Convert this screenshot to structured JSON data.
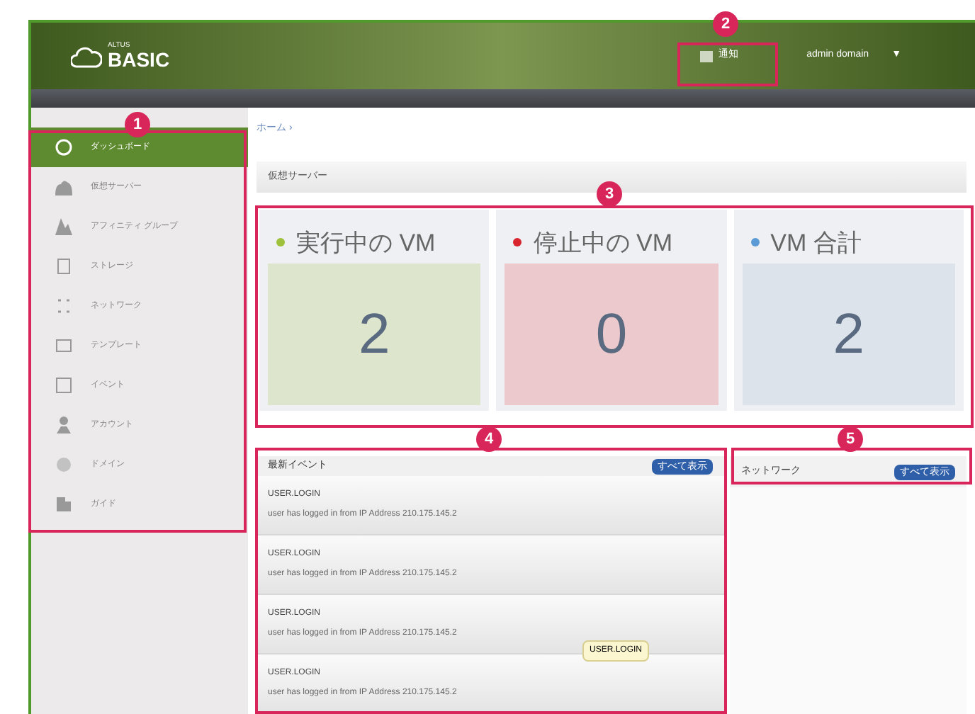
{
  "header": {
    "logo_small": "ALTUS",
    "logo": "BASIC",
    "notification": "通知",
    "account": "admin domain",
    "caret": "▼"
  },
  "sidebar": {
    "items": [
      {
        "label": "ダッシュボード",
        "selected": true
      },
      {
        "label": "仮想サーバー",
        "selected": false
      },
      {
        "label": "アフィニティ グループ",
        "selected": false
      },
      {
        "label": "ストレージ",
        "selected": false
      },
      {
        "label": "ネットワーク",
        "selected": false
      },
      {
        "label": "テンプレート",
        "selected": false
      },
      {
        "label": "イベント",
        "selected": false
      },
      {
        "label": "アカウント",
        "selected": false
      },
      {
        "label": "ドメイン",
        "selected": false
      },
      {
        "label": "ガイド",
        "selected": false
      }
    ]
  },
  "breadcrumb": "ホーム ›",
  "section_title": "仮想サーバー",
  "stats": [
    {
      "label": "実行中の VM",
      "value": "2",
      "color": "#9dc13a"
    },
    {
      "label": "停止中の VM",
      "value": "0",
      "color": "#d9262e"
    },
    {
      "label": "VM 合計",
      "value": "2",
      "color": "#5b9bd5"
    }
  ],
  "events": {
    "title": "最新イベント",
    "button": "すべて表示",
    "items": [
      {
        "type": "USER.LOGIN",
        "text": "user has logged in from IP Address 210.175.145.2"
      },
      {
        "type": "USER.LOGIN",
        "text": "user has logged in from IP Address 210.175.145.2"
      },
      {
        "type": "USER.LOGIN",
        "text": "user has logged in from IP Address 210.175.145.2"
      },
      {
        "type": "USER.LOGIN",
        "text": "user has logged in from IP Address 210.175.145.2"
      }
    ],
    "tooltip": "USER.LOGIN"
  },
  "network": {
    "title": "ネットワーク",
    "button": "すべて表示"
  },
  "callouts": [
    "1",
    "2",
    "3",
    "4",
    "5"
  ]
}
